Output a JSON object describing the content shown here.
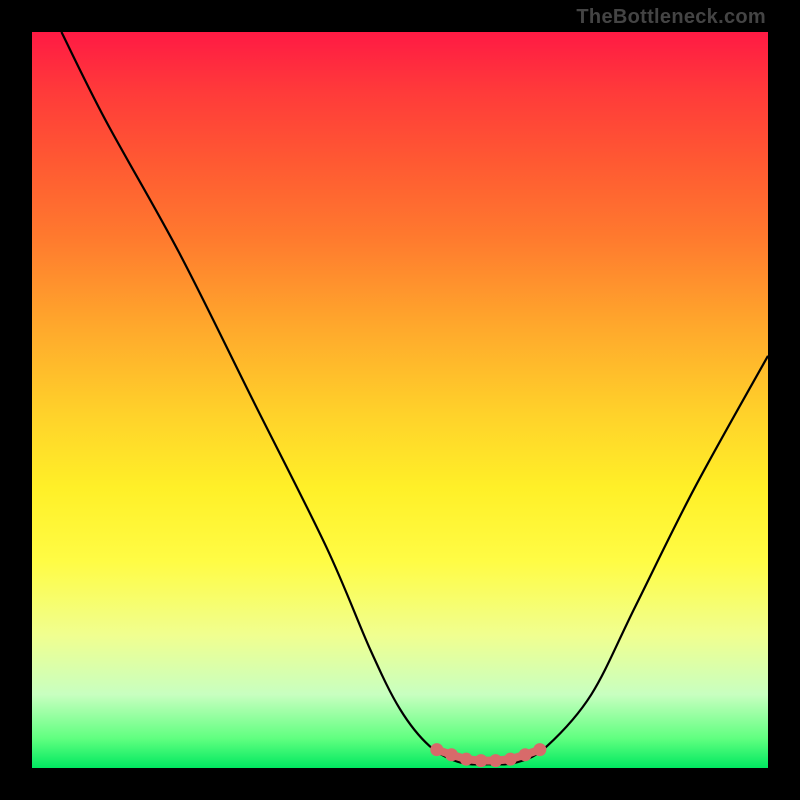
{
  "watermark": "TheBottleneck.com",
  "chart_data": {
    "type": "line",
    "title": "",
    "xlabel": "",
    "ylabel": "",
    "xlim": [
      0,
      100
    ],
    "ylim": [
      0,
      100
    ],
    "series": [
      {
        "name": "bottleneck-curve",
        "x": [
          4,
          10,
          20,
          30,
          40,
          46,
          50,
          54,
          58,
          62,
          66,
          70,
          76,
          82,
          90,
          100
        ],
        "values": [
          100,
          88,
          70,
          50,
          30,
          16,
          8,
          3,
          0.8,
          0.5,
          0.8,
          3,
          10,
          22,
          38,
          56
        ]
      },
      {
        "name": "sweet-spot-dots",
        "x": [
          55,
          57,
          59,
          61,
          63,
          65,
          67,
          69
        ],
        "values": [
          2.5,
          1.8,
          1.2,
          1.0,
          1.0,
          1.2,
          1.8,
          2.5
        ]
      }
    ],
    "gradient_stops": [
      {
        "pct": 0,
        "color": "#ff1a44"
      },
      {
        "pct": 50,
        "color": "#ffd22a"
      },
      {
        "pct": 100,
        "color": "#00e860"
      }
    ]
  }
}
